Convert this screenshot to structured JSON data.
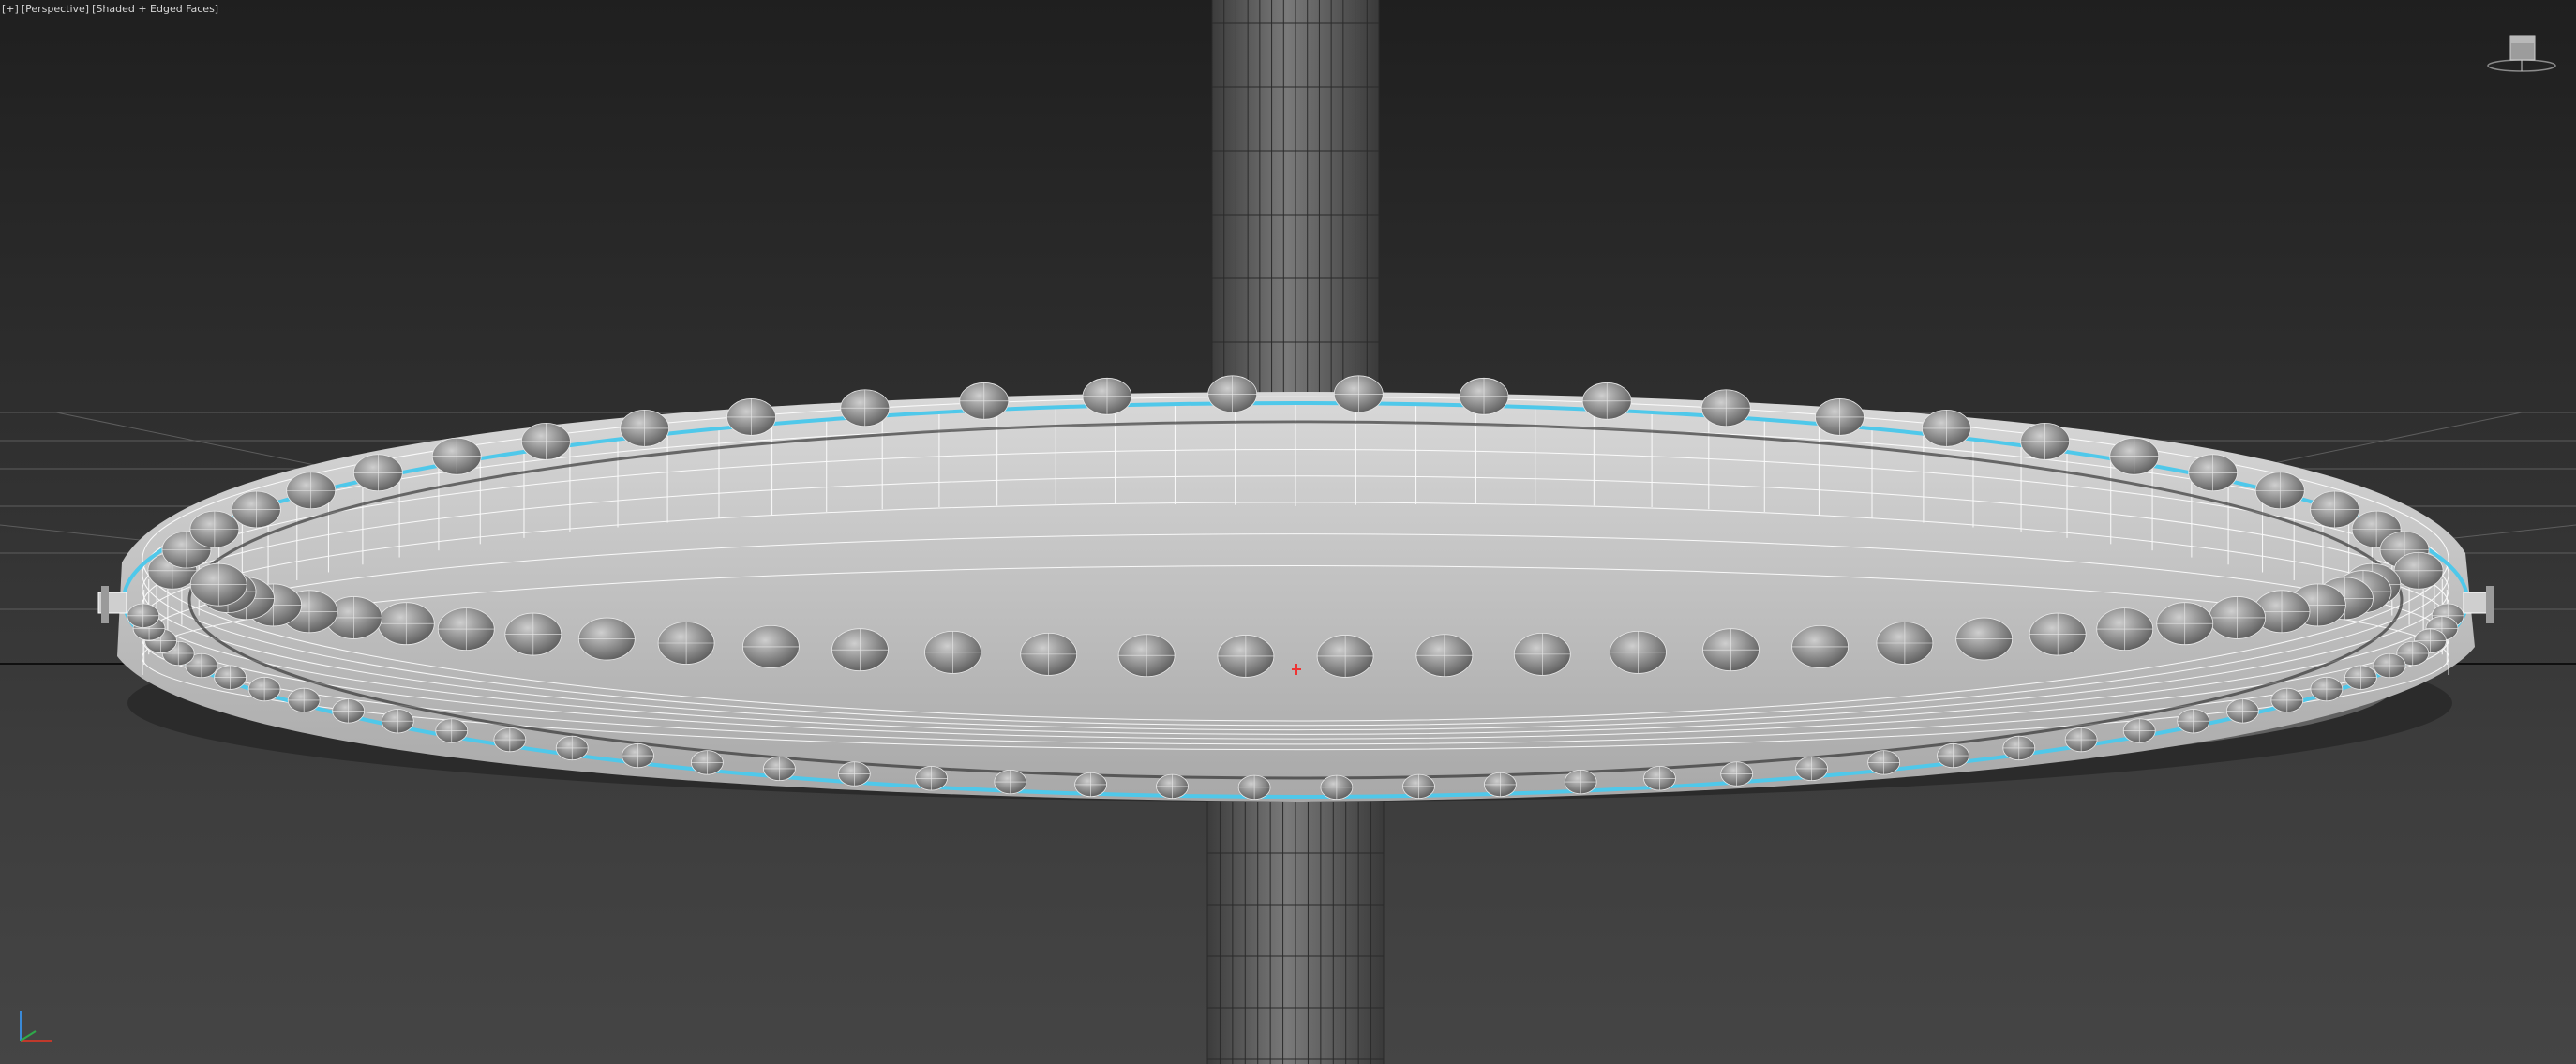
{
  "viewport": {
    "label_menu": "[+]",
    "label_view": "[Perspective]",
    "label_shading": "[Shaded + Edged Faces]"
  },
  "scene": {
    "selection_color": "#4fc8ea",
    "wire_color": "#f2f2f2",
    "shaft_color": "#6e6e6e",
    "background_top": "#1f1f1f",
    "background_bottom": "#454545"
  },
  "viewcube": {
    "icon": "viewcube-icon"
  },
  "axis_tripod": {
    "icon": "axis-tripod-icon",
    "x_color": "#c0392b",
    "y_color": "#3a8ad8"
  }
}
